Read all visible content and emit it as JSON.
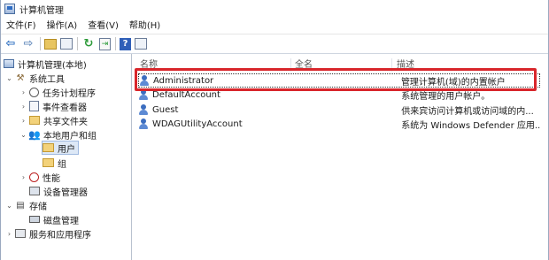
{
  "window": {
    "title": "计算机管理"
  },
  "menu": [
    {
      "label": "文件(F)"
    },
    {
      "label": "操作(A)"
    },
    {
      "label": "查看(V)"
    },
    {
      "label": "帮助(H)"
    }
  ],
  "toolbar": {
    "icons": [
      "back-arrow-icon",
      "forward-arrow-icon",
      "up-folder-icon",
      "show-hide-tree-icon",
      "refresh-icon",
      "export-list-icon",
      "help-icon",
      "properties-icon"
    ],
    "glyphs": {
      "back": "⇦",
      "forward": "⇨",
      "refresh": "↻",
      "export": "⇥",
      "help": "?"
    }
  },
  "tree": {
    "items": [
      {
        "label": "计算机管理(本地)",
        "icon": "computer-icon"
      },
      {
        "label": "系统工具",
        "icon": "tools-icon",
        "twisty": "⌄"
      },
      {
        "label": "任务计划程序",
        "icon": "clock-icon",
        "twisty": "›"
      },
      {
        "label": "事件查看器",
        "icon": "event-viewer-icon",
        "twisty": "›"
      },
      {
        "label": "共享文件夹",
        "icon": "shared-folder-icon",
        "twisty": "›"
      },
      {
        "label": "本地用户和组",
        "icon": "users-icon",
        "twisty": "⌄"
      },
      {
        "label": "用户",
        "icon": "folder-icon"
      },
      {
        "label": "组",
        "icon": "folder-icon"
      },
      {
        "label": "性能",
        "icon": "performance-icon",
        "twisty": "›"
      },
      {
        "label": "设备管理器",
        "icon": "device-manager-icon"
      },
      {
        "label": "存储",
        "icon": "storage-icon",
        "twisty": "⌄"
      },
      {
        "label": "磁盘管理",
        "icon": "disk-icon"
      },
      {
        "label": "服务和应用程序",
        "icon": "services-icon",
        "twisty": "›"
      }
    ]
  },
  "list": {
    "columns": [
      "名称",
      "全名",
      "描述"
    ],
    "rows": [
      {
        "name": "Administrator",
        "fullname": "",
        "desc": "管理计算机(域)的内置帐户"
      },
      {
        "name": "DefaultAccount",
        "fullname": "",
        "desc": "系统管理的用户帐户。"
      },
      {
        "name": "Guest",
        "fullname": "",
        "desc": "供来宾访问计算机或访问域的内..."
      },
      {
        "name": "WDAGUtilityAccount",
        "fullname": "",
        "desc": "系统为 Windows Defender 应用..."
      }
    ]
  },
  "colors": {
    "highlight": "#d8262b",
    "selection": "#dde8f6"
  }
}
